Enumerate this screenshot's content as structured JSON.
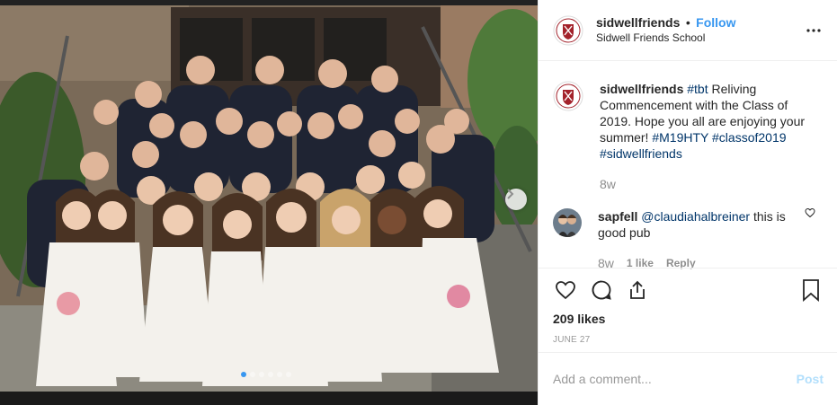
{
  "post": {
    "author": "sidwellfriends",
    "separator": "•",
    "follow_label": "Follow",
    "location": "Sidwell Friends School",
    "more_icon": "ellipsis-icon"
  },
  "photo": {
    "description_icon": "graduation-group-photo",
    "carousel_dots": 6,
    "active_dot": 0,
    "next_icon": "chevron-right-icon"
  },
  "caption": {
    "username": "sidwellfriends",
    "parts": [
      {
        "text": "#tbt",
        "tag": true
      },
      {
        "text": " Reliving Commencement with the Class of 2019. Hope you all are enjoying your summer! ",
        "tag": false
      },
      {
        "text": "#M19HTY",
        "tag": true
      },
      {
        "text": " ",
        "tag": false
      },
      {
        "text": "#classof2019",
        "tag": true
      },
      {
        "text": " ",
        "tag": false
      },
      {
        "text": "#sidwellfriends",
        "tag": true
      }
    ],
    "time": "8w"
  },
  "comment": {
    "username": "sapfell",
    "mention": "@claudiahalbreiner",
    "text": " this is good pub",
    "time": "8w",
    "likes": "1 like",
    "reply": "Reply"
  },
  "actions": {
    "like_icon": "heart-icon",
    "comment_icon": "comment-icon",
    "share_icon": "share-icon",
    "save_icon": "bookmark-icon"
  },
  "likes": "209 likes",
  "date": "JUNE 27",
  "add_comment": {
    "placeholder": "Add a comment...",
    "post_label": "Post"
  },
  "colors": {
    "link": "#3897f0",
    "hashtag": "#003569",
    "crest": "#a3222b",
    "post_disabled": "#b2dffc"
  }
}
